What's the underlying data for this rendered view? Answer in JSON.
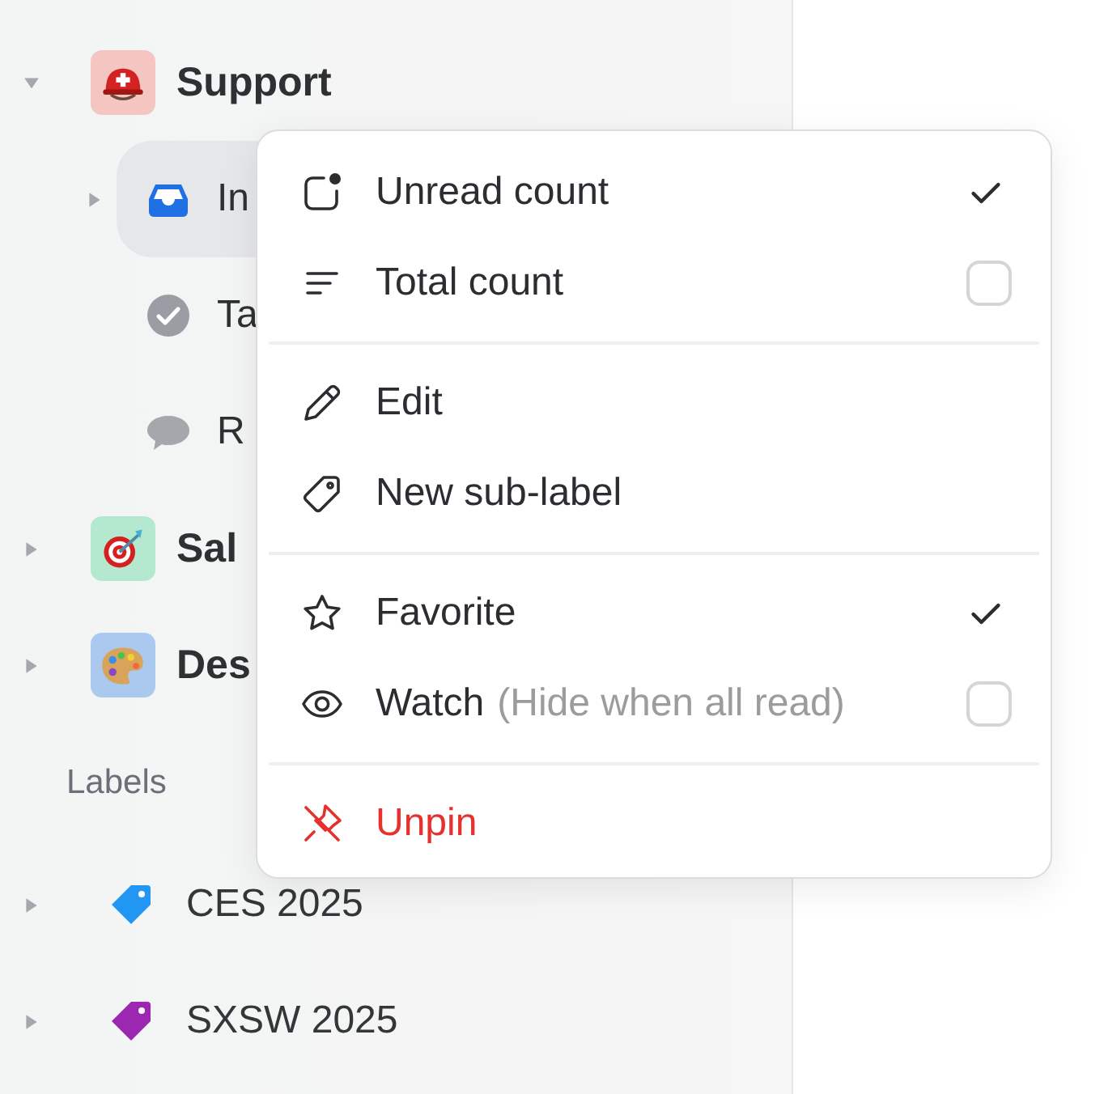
{
  "sidebar": {
    "groups": [
      {
        "name": "Support",
        "kind": "helmet",
        "color": "#f4c5c1",
        "expanded": true,
        "children": [
          {
            "label": "In",
            "kind": "inbox",
            "selected": true,
            "expandable": true
          },
          {
            "label": "Ta",
            "kind": "task",
            "selected": false,
            "expandable": false
          },
          {
            "label": "R",
            "kind": "reply",
            "selected": false,
            "expandable": false
          }
        ]
      },
      {
        "name": "Sal",
        "kind": "target",
        "color": "#b4e8cf",
        "expanded": false
      },
      {
        "name": "Des",
        "kind": "palette",
        "color": "#abc8ef",
        "expanded": false
      }
    ],
    "labels_heading": "Labels",
    "labels": [
      {
        "name": "CES 2025",
        "color": "#2196f3",
        "expanded": false
      },
      {
        "name": "SXSW 2025",
        "color": "#9c27b0",
        "expanded": false
      }
    ]
  },
  "context_menu": {
    "sections": [
      [
        {
          "label": "Unread count",
          "kind": "toggle",
          "checked": true
        },
        {
          "label": "Total count",
          "kind": "toggle",
          "checked": false
        }
      ],
      [
        {
          "label": "Edit",
          "kind": "action"
        },
        {
          "label": "New sub-label",
          "kind": "action"
        }
      ],
      [
        {
          "label": "Favorite",
          "kind": "toggle",
          "checked": true
        },
        {
          "label": "Watch",
          "note": "(Hide when all read)",
          "kind": "toggle",
          "checked": false
        }
      ],
      [
        {
          "label": "Unpin",
          "kind": "danger"
        }
      ]
    ]
  }
}
